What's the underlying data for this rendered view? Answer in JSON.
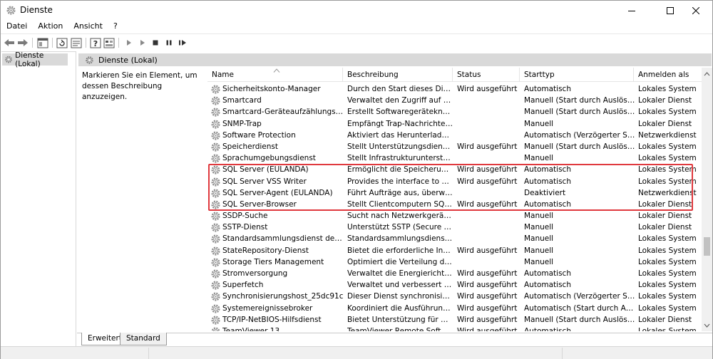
{
  "window": {
    "title": "Dienste"
  },
  "menu": [
    "Datei",
    "Aktion",
    "Ansicht",
    "?"
  ],
  "tree": {
    "item": "Dienste (Lokal)"
  },
  "main": {
    "header": "Dienste (Lokal)",
    "hint": "Markieren Sie ein Element, um dessen Beschreibung anzuzeigen."
  },
  "columns": {
    "name": "Name",
    "description": "Beschreibung",
    "status": "Status",
    "starttype": "Starttyp",
    "logon": "Anmelden als"
  },
  "services": [
    {
      "name": "Sicherheitskonto-Manager",
      "description": "Durch den Start dieses Diensts...",
      "status": "Wird ausgeführt",
      "starttype": "Automatisch",
      "logon": "Lokales System"
    },
    {
      "name": "Smartcard",
      "description": "Verwaltet den Zugriff auf Sma...",
      "status": "",
      "starttype": "Manuell (Start durch Auslöser)",
      "logon": "Lokaler Dienst"
    },
    {
      "name": "Smartcard-Geräteaufzählungsdienst",
      "description": "Erstellt Softwaregeräteknoten ...",
      "status": "",
      "starttype": "Manuell (Start durch Auslöser)",
      "logon": "Lokales System"
    },
    {
      "name": "SNMP-Trap",
      "description": "Empfängt Trap-Nachrichten, ...",
      "status": "",
      "starttype": "Manuell",
      "logon": "Lokaler Dienst"
    },
    {
      "name": "Software Protection",
      "description": "Aktiviert das Herunterladen, d...",
      "status": "",
      "starttype": "Automatisch (Verzögerter Start,...",
      "logon": "Netzwerkdienst"
    },
    {
      "name": "Speicherdienst",
      "description": "Stellt Unterstützungsdienste f...",
      "status": "Wird ausgeführt",
      "starttype": "Manuell (Start durch Auslöser)",
      "logon": "Lokales System"
    },
    {
      "name": "Sprachumgebungsdienst",
      "description": "Stellt Infrastrukturunterstützu...",
      "status": "",
      "starttype": "Manuell",
      "logon": "Lokales System"
    },
    {
      "name": "SQL Server (EULANDA)",
      "description": "Ermöglicht die Speicherung, ...",
      "status": "Wird ausgeführt",
      "starttype": "Automatisch",
      "logon": "Lokales System"
    },
    {
      "name": "SQL Server VSS Writer",
      "description": "Provides the interface to back...",
      "status": "Wird ausgeführt",
      "starttype": "Automatisch",
      "logon": "Lokales System"
    },
    {
      "name": "SQL Server-Agent (EULANDA)",
      "description": "Führt Aufträge aus, überwach...",
      "status": "",
      "starttype": "Deaktiviert",
      "logon": "Netzwerkdienst"
    },
    {
      "name": "SQL Server-Browser",
      "description": "Stellt Clientcomputern SQL Se...",
      "status": "Wird ausgeführt",
      "starttype": "Automatisch",
      "logon": "Lokaler Dienst"
    },
    {
      "name": "SSDP-Suche",
      "description": "Sucht nach Netzwerkgeräten ...",
      "status": "",
      "starttype": "Manuell",
      "logon": "Lokaler Dienst"
    },
    {
      "name": "SSTP-Dienst",
      "description": "Unterstützt SSTP (Secure Sock...",
      "status": "",
      "starttype": "Manuell",
      "logon": "Lokaler Dienst"
    },
    {
      "name": "Standardsammlungsdienst des Mic...",
      "description": "Standardsammlungsdienst de...",
      "status": "",
      "starttype": "Manuell",
      "logon": "Lokales System"
    },
    {
      "name": "StateRepository-Dienst",
      "description": "Bietet die erforderliche Infrast...",
      "status": "Wird ausgeführt",
      "starttype": "Manuell",
      "logon": "Lokales System"
    },
    {
      "name": "Storage Tiers Management",
      "description": "Optimiert die Verteilung der D...",
      "status": "",
      "starttype": "Manuell",
      "logon": "Lokales System"
    },
    {
      "name": "Stromversorgung",
      "description": "Verwaltet die Energierichtlinie ...",
      "status": "Wird ausgeführt",
      "starttype": "Automatisch",
      "logon": "Lokales System"
    },
    {
      "name": "Superfetch",
      "description": "Verwaltet und verbessert die S...",
      "status": "Wird ausgeführt",
      "starttype": "Automatisch",
      "logon": "Lokales System"
    },
    {
      "name": "Synchronisierungshost_25dc91c",
      "description": "Dieser Dienst synchronisiert E...",
      "status": "Wird ausgeführt",
      "starttype": "Automatisch (Verzögerter Start)",
      "logon": "Lokales System"
    },
    {
      "name": "Systemereignissebroker",
      "description": "Koordiniert die Ausführung d...",
      "status": "Wird ausgeführt",
      "starttype": "Automatisch (Start durch Auslö...",
      "logon": "Lokales System"
    },
    {
      "name": "TCP/IP-NetBIOS-Hilfsdienst",
      "description": "Bietet Unterstützung für den ...",
      "status": "Wird ausgeführt",
      "starttype": "Manuell (Start durch Auslöser)",
      "logon": "Lokaler Dienst"
    },
    {
      "name": "TeamViewer 13",
      "description": "TeamViewer Remote Software",
      "status": "Wird ausgeführt",
      "starttype": "Automatisch",
      "logon": "Lokales System"
    }
  ],
  "tabs": [
    "Erweitert",
    "Standard"
  ],
  "colors": {
    "highlight": "#e0393e",
    "selection": "#d9d9d9"
  }
}
